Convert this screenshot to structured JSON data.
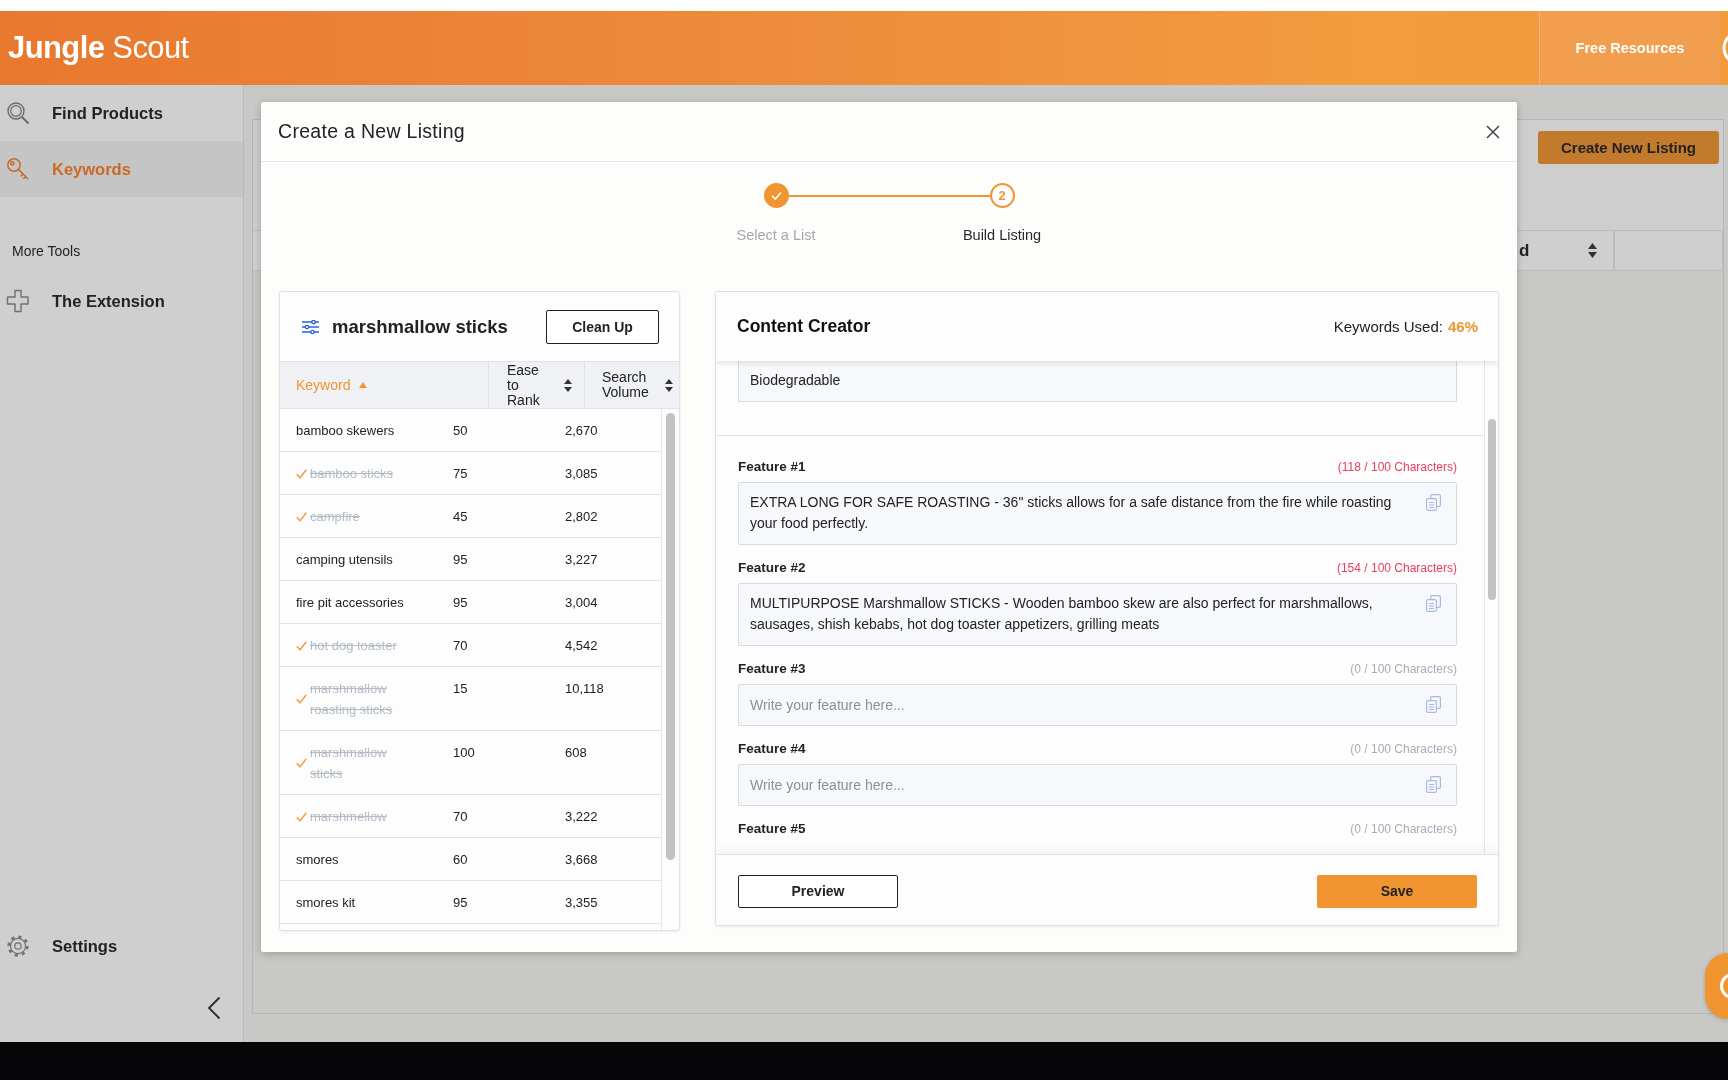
{
  "header": {
    "logo": "**Jungle** Scout",
    "links": [
      "Free Resources"
    ]
  },
  "sidebar": {
    "items": [
      {
        "label": "Find Products",
        "selected": false
      },
      {
        "label": "Keywords",
        "selected": true
      }
    ],
    "section_label": "More Tools",
    "tools": [
      {
        "label": "The Extension"
      }
    ],
    "settings": "Settings"
  },
  "background": {
    "button": "Create New Listing",
    "columns": [
      {
        "label": "d"
      }
    ]
  },
  "modal": {
    "title": "Create a New Listing",
    "steps": [
      {
        "label": "Select a List",
        "completed": true,
        "selected": false
      },
      {
        "number": "2",
        "label": "Build Listing",
        "completed": false,
        "selected": true
      }
    ],
    "keyword_list": {
      "title": "marshmallow sticks",
      "clean_up_button": "Clean Up",
      "columns": [
        {
          "label": "Keyword",
          "sorted": true
        },
        {
          "label": "Ease to Rank",
          "sorted": false
        },
        {
          "label": "Search Volume",
          "sorted": false
        }
      ],
      "rows": [
        {
          "keyword": "bamboo skewers",
          "ease_to_rank": "50",
          "search_volume": "2,670",
          "used": false
        },
        {
          "keyword": "bamboo sticks",
          "ease_to_rank": "75",
          "search_volume": "3,085",
          "used": true
        },
        {
          "keyword": "campfire",
          "ease_to_rank": "45",
          "search_volume": "2,802",
          "used": true
        },
        {
          "keyword": "camping utensils",
          "ease_to_rank": "95",
          "search_volume": "3,227",
          "used": false
        },
        {
          "keyword": "fire pit accessories",
          "ease_to_rank": "95",
          "search_volume": "3,004",
          "used": false
        },
        {
          "keyword": "hot dog toaster",
          "ease_to_rank": "70",
          "search_volume": "4,542",
          "used": true
        },
        {
          "keyword": "marshmallow roasting sticks",
          "ease_to_rank": "15",
          "search_volume": "10,118",
          "used": true
        },
        {
          "keyword": "marshmallow sticks",
          "ease_to_rank": "100",
          "search_volume": "608",
          "used": true
        },
        {
          "keyword": "marshmellow",
          "ease_to_rank": "70",
          "search_volume": "3,222",
          "used": true
        },
        {
          "keyword": "smores",
          "ease_to_rank": "60",
          "search_volume": "3,668",
          "used": false
        },
        {
          "keyword": "smores kit",
          "ease_to_rank": "95",
          "search_volume": "3,355",
          "used": false
        }
      ]
    },
    "content_creator": {
      "title": "Content Creator",
      "keywords_used_label": "Keywords Used:",
      "keywords_used_value": "46%",
      "description_value": "Biodegradable",
      "features": [
        {
          "label": "Feature #1",
          "count": "(118 / 100 Characters)",
          "over_limit": true,
          "value": "EXTRA LONG FOR SAFE ROASTING - 36\" sticks allows for a safe distance from the fire while roasting your food perfectly."
        },
        {
          "label": "Feature #2",
          "count": "(154 / 100 Characters)",
          "over_limit": true,
          "value": "MULTIPURPOSE Marshmallow STICKS - Wooden bamboo skew are also perfect for marshmallows, sausages, shish kebabs, hot dog toaster appetizers, grilling meats"
        },
        {
          "label": "Feature #3",
          "count": "(0 / 100 Characters)",
          "over_limit": false,
          "placeholder": "Write your feature here..."
        },
        {
          "label": "Feature #4",
          "count": "(0 / 100 Characters)",
          "over_limit": false,
          "placeholder": "Write your feature here..."
        },
        {
          "label": "Feature #5",
          "count": "(0 / 100 Characters)",
          "over_limit": false
        }
      ],
      "preview_button": "Preview",
      "save_button": "Save"
    }
  }
}
